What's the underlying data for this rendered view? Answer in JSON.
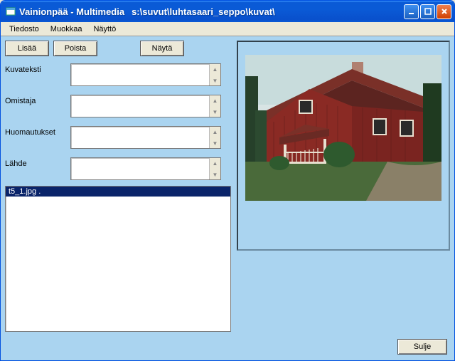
{
  "window": {
    "title": "Vainionpää - Multimedia",
    "path": "s:\\suvut\\luhtasaari_seppo\\kuvat\\"
  },
  "menubar": {
    "items": [
      "Tiedosto",
      "Muokkaa",
      "Näyttö"
    ]
  },
  "toolbar": {
    "add": "Lisää",
    "remove": "Poista",
    "show": "Näytä"
  },
  "form": {
    "caption_label": "Kuvateksti",
    "caption_value": "",
    "owner_label": "Omistaja",
    "owner_value": "",
    "notes_label": "Huomautukset",
    "notes_value": "",
    "source_label": "Lähde",
    "source_value": ""
  },
  "filelist": {
    "items": [
      "t5_1.jpg ."
    ],
    "selected_index": 0
  },
  "footer": {
    "close": "Sulje"
  }
}
